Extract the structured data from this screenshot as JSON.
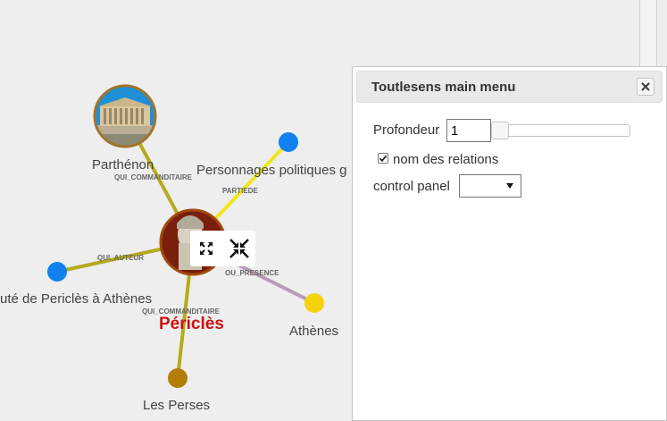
{
  "graph": {
    "nodes": {
      "parthenon": "Parthénon",
      "personnages": "Personnages politiques g",
      "statue": "uté de Periclès à Athènes",
      "pericles": "Périclès",
      "athenes": "Athènes",
      "perses": "Les Perses"
    },
    "edges": {
      "commanditaire_top": "QUI_COMMANDITAIRE",
      "partiede": "PARTIEDE",
      "auteur": "QUI_AUTEUR",
      "presence": "OU_PRESENCE",
      "commanditaire_bottom": "QUI_COMMANDITAIRE"
    },
    "node_colors": {
      "personnages": "#1181f0",
      "statue": "#1181f0",
      "athenes": "#f5d20b",
      "perses": "#b47d06"
    },
    "edge_colors": {
      "commanditaire": "#b5ab1e",
      "partiede": "#f0e61c",
      "presence": "#b69db5"
    }
  },
  "node_tools": {
    "expand_icon": "expand-icon",
    "collapse_icon": "collapse-icon"
  },
  "menu": {
    "title": "Toutlesens main menu",
    "depth_label": "Profondeur",
    "depth_value": "1",
    "relation_names_label": "nom des relations",
    "relation_names_checked": true,
    "control_panel_label": "control panel",
    "control_panel_value": ""
  }
}
